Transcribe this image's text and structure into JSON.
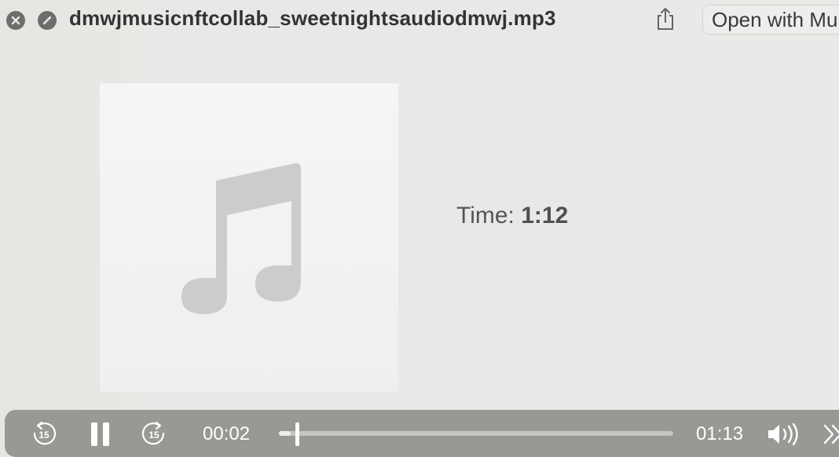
{
  "window": {
    "title": "dmwjmusicnftcollab_sweetnightsaudiodmwj.mp3",
    "open_with_label": "Open with Mu"
  },
  "info": {
    "time_label": "Time:",
    "time_value": "1:12"
  },
  "player": {
    "skip_back_label": "15",
    "skip_forward_label": "15",
    "elapsed": "00:02",
    "total": "01:13",
    "progress_fraction": 0.03
  },
  "icons": {
    "close": "close-icon",
    "block": "slash-circle-icon",
    "share": "share-icon",
    "artwork": "music-note-icon",
    "volume": "speaker-icon",
    "more": "chevron-right-icon"
  },
  "colors": {
    "control_bar": "#9a9894",
    "artwork_note": "#cccccc"
  }
}
